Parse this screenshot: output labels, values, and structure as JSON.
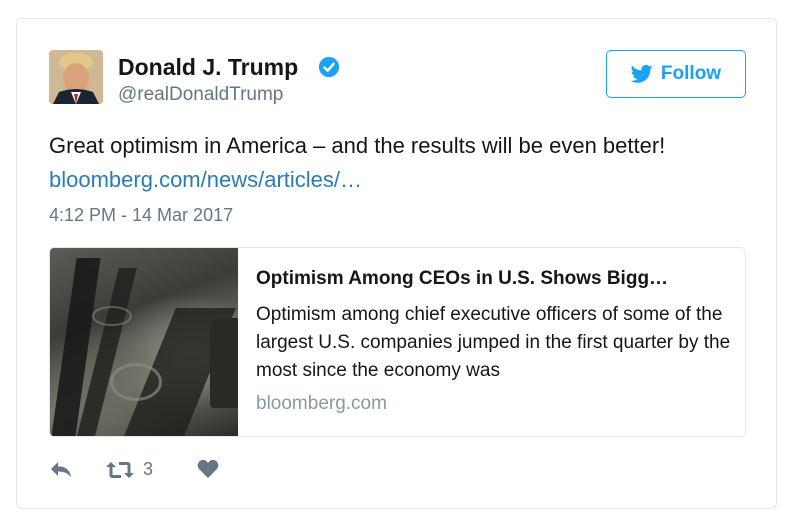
{
  "tweet": {
    "author_name": "Donald J. Trump",
    "author_handle": "@realDonaldTrump",
    "follow_label": "Follow",
    "text": "Great optimism in America – and the results will be even better!",
    "link_text": "bloomberg.com/news/articles/…",
    "timestamp": "4:12 PM - 14 Mar 2017",
    "retweet_count": "3"
  },
  "preview": {
    "title": "Optimism Among CEOs in U.S. Shows Bigg…",
    "description": "Optimism among chief executive officers of some of the largest U.S. companies jumped in the first quarter by the most since the economy was",
    "domain": "bloomberg.com"
  },
  "icons": {
    "verified": "verified-badge-icon",
    "follow": "twitter-bird-icon",
    "reply": "reply-icon",
    "retweet": "retweet-icon",
    "like": "heart-icon"
  },
  "colors": {
    "accent": "#1da1f2",
    "link": "#2b7bb9",
    "muted": "#657786",
    "border": "#e1e8ed"
  }
}
